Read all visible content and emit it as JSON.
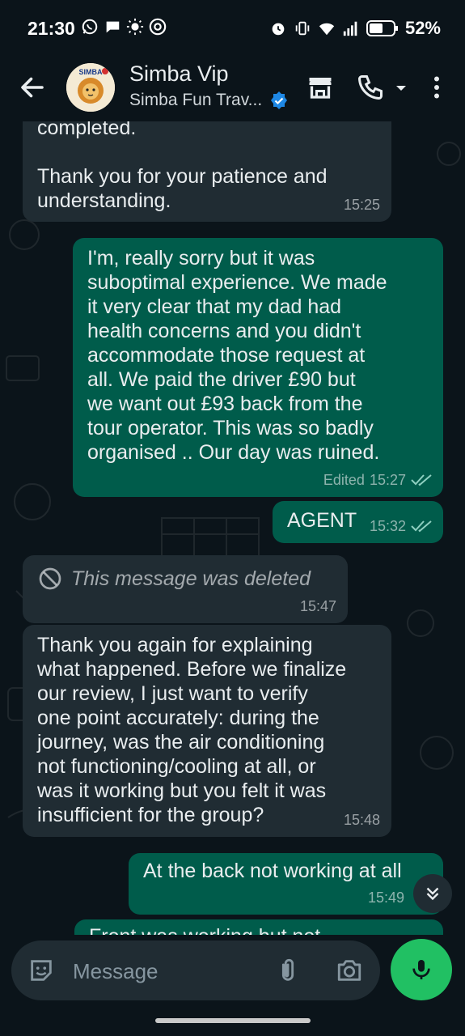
{
  "status_bar": {
    "time": "21:30",
    "battery": "52%",
    "left_icons": [
      "whatsapp-icon",
      "chat-icon",
      "brightness-icon",
      "chrome-icon"
    ],
    "right_icons": [
      "alarm-icon",
      "vibrate-icon",
      "wifi-icon",
      "signal-icon",
      "battery-icon"
    ]
  },
  "header": {
    "name": "Simba Vip",
    "subtitle": "Simba Fun Trav...",
    "avatar_label": "SIMBA",
    "icons": [
      "back-arrow-icon",
      "store-icon",
      "phone-icon",
      "dropdown-icon",
      "more-vert-icon"
    ]
  },
  "messages": [
    {
      "dir": "in",
      "text": "completed.\n\nThank you for your patience and\nunderstanding.",
      "time": "15:25"
    },
    {
      "dir": "out",
      "text": "I'm, really sorry but it was\nsuboptimal experience. We made\nit very clear that my dad had\nhealth concerns and you didn't\naccommodate those request at\nall. We paid the driver £90 but\nwe want out £93 back from the\ntour operator. This was so badly\norganised .. Our day was ruined.",
      "time": "15:27",
      "edited": "Edited",
      "read": true
    },
    {
      "dir": "out",
      "text": "AGENT",
      "time": "15:32",
      "read": true
    },
    {
      "dir": "in",
      "text": "This message was deleted",
      "time": "15:47",
      "deleted": true
    },
    {
      "dir": "in",
      "text": "Thank you again for explaining\nwhat happened. Before we finalize\nour review, I just want to verify\none point accurately: during the\njourney, was the air conditioning\nnot functioning/cooling at all, or\nwas it working but you felt it was\ninsufficient for the group?",
      "time": "15:48"
    },
    {
      "dir": "out",
      "text": "At the back not working at all",
      "time": "15:49"
    },
    {
      "dir": "out",
      "text": "Front was working but not",
      "time": ""
    }
  ],
  "input": {
    "placeholder": "Message"
  },
  "colors": {
    "background": "#0b141a",
    "incoming": "#202c33",
    "outgoing": "#005c4b",
    "accent": "#21c063",
    "read_ticks": "#8ecfc0"
  }
}
